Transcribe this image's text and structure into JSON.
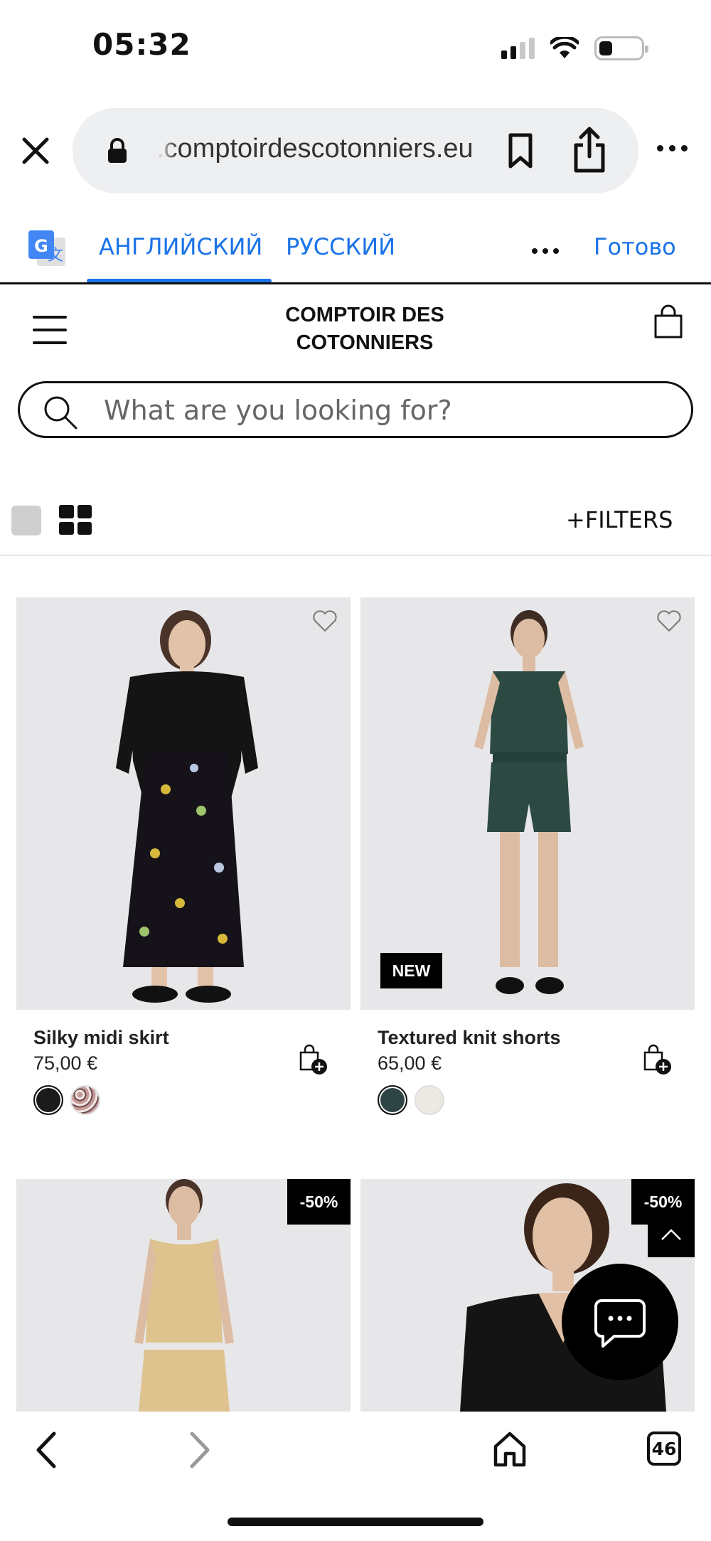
{
  "status_bar": {
    "time": "05:32"
  },
  "browser": {
    "url": ".comptoirdescotonniers.eu",
    "tab_count": "46"
  },
  "translate_bar": {
    "tab_source": "АНГЛИЙСКИЙ",
    "tab_target": "РУССКИЙ",
    "done": "Готово",
    "accent_color": "#1a73e8"
  },
  "site": {
    "brand_line1": "COMPTOIR DES",
    "brand_line2": "COTONNIERS",
    "search_placeholder": "What are you looking for?",
    "filters_label": "+FILTERS"
  },
  "products": [
    {
      "name": "Silky midi skirt",
      "price": "75,00 €",
      "badge": "",
      "swatches": [
        "#1b1b1b",
        "#b98c8c"
      ]
    },
    {
      "name": "Textured knit shorts",
      "price": "65,00 €",
      "badge": "NEW",
      "swatches": [
        "#2f4545",
        "#ece9e2"
      ]
    },
    {
      "name": "",
      "price": "",
      "badge": "-50%"
    },
    {
      "name": "",
      "price": "",
      "badge": "-50%"
    }
  ]
}
